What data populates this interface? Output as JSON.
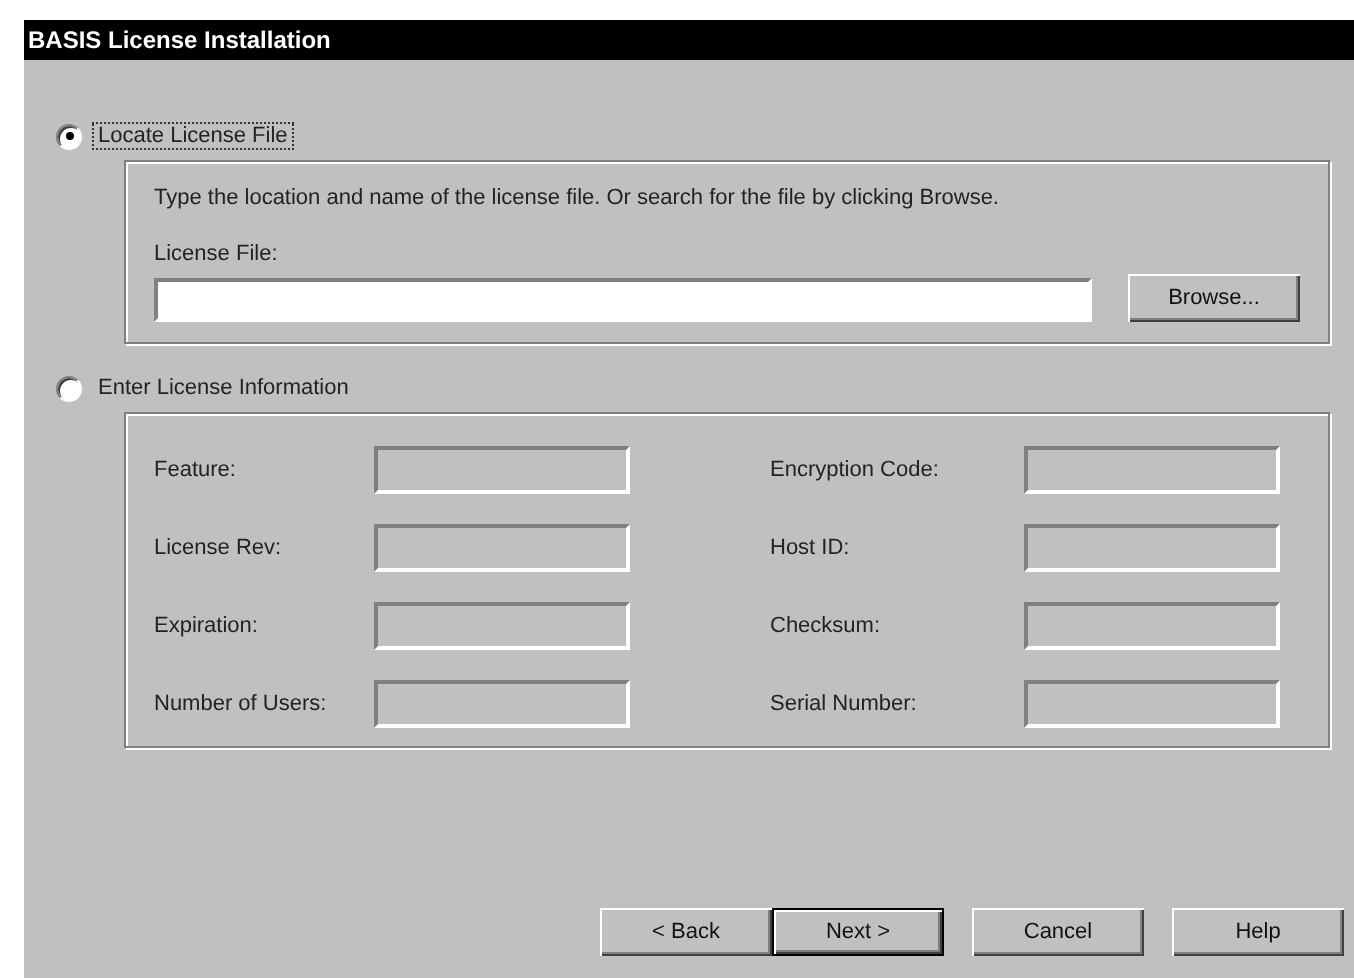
{
  "window": {
    "title": "BASIS License Installation"
  },
  "options": [
    {
      "label": "Locate License File",
      "selected": true,
      "focused": true
    },
    {
      "label": "Enter License Information",
      "selected": false,
      "focused": false
    }
  ],
  "locate": {
    "instructions": "Type the location and name of the license file.  Or search for the file by clicking Browse.",
    "field_label": "License File:",
    "browse": "Browse..."
  },
  "info_fields": [
    {
      "label": "Feature:",
      "disabled": true
    },
    {
      "label": "Encryption Code:",
      "disabled": true
    },
    {
      "label": "License Rev:",
      "disabled": true
    },
    {
      "label": "Host ID:",
      "disabled": true
    },
    {
      "label": "Expiration:",
      "disabled": true
    },
    {
      "label": "Checksum:",
      "disabled": true
    },
    {
      "label": "Number of Users:",
      "disabled": true
    },
    {
      "label": "Serial Number:",
      "disabled": true
    }
  ],
  "buttons": [
    {
      "label": "< Back",
      "default": false
    },
    {
      "label": "Next >",
      "default": true
    },
    {
      "label": "Cancel",
      "default": false
    },
    {
      "label": "Help",
      "default": false
    }
  ]
}
